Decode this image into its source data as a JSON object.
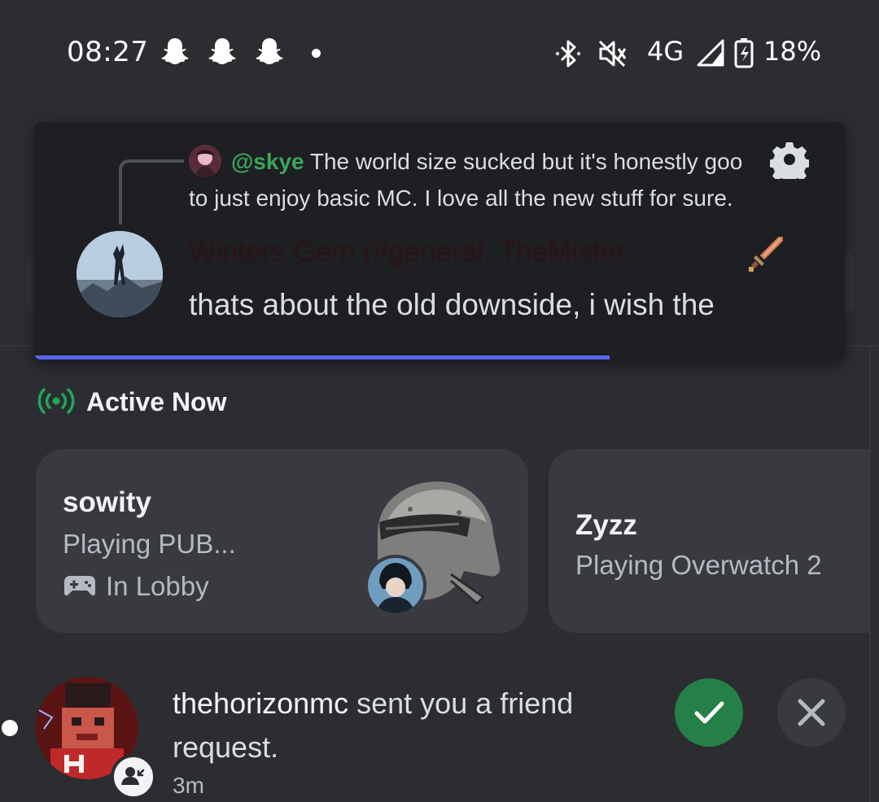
{
  "status_bar": {
    "time": "08:27",
    "network": "4G",
    "battery": "18%",
    "notification_icons": [
      "snapchat-icon",
      "snapchat-icon",
      "snapchat-icon",
      "dot-icon"
    ],
    "system_icons": [
      "bluetooth-icon",
      "mute-icon",
      "signal-icon",
      "battery-charging-icon"
    ]
  },
  "notification": {
    "reply_mention": "@skye",
    "reply_text": "The world size sucked but it's honestly goo",
    "reply_text_2": "to just enjoy basic MC. I love all the new stuff for sure.",
    "author": "Winters Gem (#general, TheMister...",
    "message": "thats about the old downside, i wish the",
    "progress": 0.71,
    "accent": "#5865f2"
  },
  "active_now": {
    "title": "Active Now",
    "cards": [
      {
        "name": "sowity",
        "activity": "Playing PUB...",
        "status": "In Lobby"
      },
      {
        "name": "Zyzz",
        "activity": "Playing Overwatch 2"
      }
    ]
  },
  "friend_request": {
    "username": "thehorizonmc",
    "text": "sent you a friend request.",
    "time": "3m",
    "accept_color": "#248046"
  }
}
